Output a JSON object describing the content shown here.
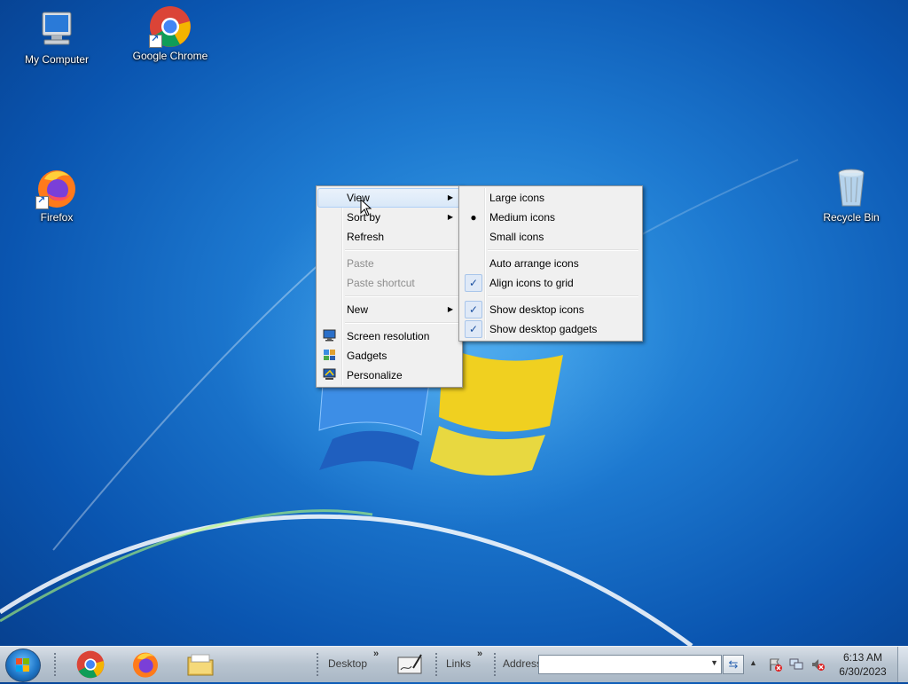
{
  "desktop": {
    "icons": [
      {
        "label": "My Computer"
      },
      {
        "label": "Google Chrome"
      },
      {
        "label": "Firefox"
      },
      {
        "label": "Recycle Bin"
      }
    ]
  },
  "context_menu": {
    "items": [
      {
        "label": "View"
      },
      {
        "label": "Sort by"
      },
      {
        "label": "Refresh"
      },
      {
        "label": "Paste"
      },
      {
        "label": "Paste shortcut"
      },
      {
        "label": "New"
      },
      {
        "label": "Screen resolution"
      },
      {
        "label": "Gadgets"
      },
      {
        "label": "Personalize"
      }
    ]
  },
  "view_submenu": {
    "items": [
      {
        "label": "Large icons"
      },
      {
        "label": "Medium icons"
      },
      {
        "label": "Small icons"
      },
      {
        "label": "Auto arrange icons"
      },
      {
        "label": "Align icons to grid"
      },
      {
        "label": "Show desktop icons"
      },
      {
        "label": "Show desktop gadgets"
      }
    ]
  },
  "taskbar": {
    "desktop_toolbar_label": "Desktop",
    "links_toolbar_label": "Links",
    "address_label": "Address",
    "address_value": "",
    "time": "6:13 AM",
    "date": "6/30/2023"
  },
  "colors": {
    "desktop_bg": "#1d79d0",
    "menu_bg": "#f0f0f0",
    "menu_hover": "#d9e8f8"
  }
}
